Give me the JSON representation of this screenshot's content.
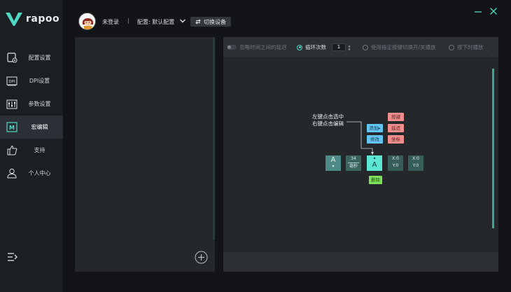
{
  "brand": {
    "name": "rapoo",
    "accent": "#4fd8c3"
  },
  "sidebar": {
    "items": [
      {
        "label": "配置设置",
        "icon": "profile-settings-icon"
      },
      {
        "label": "DPI设置",
        "icon": "dpi-icon"
      },
      {
        "label": "参数设置",
        "icon": "sliders-icon"
      },
      {
        "label": "宏编辑",
        "icon": "macro-icon",
        "active": true
      },
      {
        "label": "支持",
        "icon": "thumbs-up-icon"
      },
      {
        "label": "个人中心",
        "icon": "user-icon"
      }
    ],
    "collapse_icon": "collapse-menu-icon"
  },
  "topbar": {
    "login_status": "未登录",
    "separator": "|",
    "config_label": "配置: 默认配置",
    "switch_device": "切换设备"
  },
  "editor": {
    "options": {
      "ignore_delay": "忽略时间之间的延迟",
      "loop_count_label": "循环次数",
      "loop_count_value": "1",
      "toggle_mode": "使用指定按键切换开/关播放",
      "hold_mode": "按下时播放"
    },
    "tutorial": {
      "hint_line1": "左键点击选中",
      "hint_line2": "右键点击编辑",
      "add": "添加",
      "add_arrow": "▸",
      "modify": "修改",
      "key": "按键",
      "delay": "延迟",
      "coord": "坐标",
      "delete": "删除",
      "key_a": "A",
      "arrow_down": "▾",
      "arrow_up": "▴",
      "delay_value": "34",
      "delay_unit": "毫秒",
      "x_label": "X:0",
      "y_label": "Y:0"
    }
  }
}
